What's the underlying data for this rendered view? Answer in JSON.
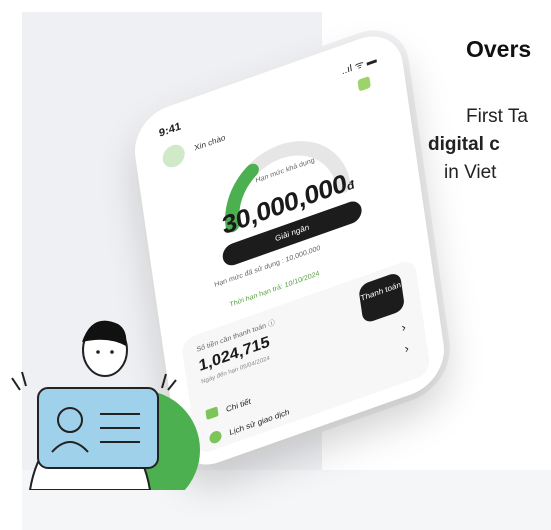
{
  "overview": {
    "heading": "Overs",
    "line1": "First Ta",
    "line2": "digital c",
    "line3": "in Viet"
  },
  "phone": {
    "time": "9:41",
    "signal": "..ıl ᯤ ▬",
    "greeting": "Xin chào",
    "limit_label": "Hạn mức khả dụng",
    "amount": "30,000,000",
    "currency": "đ",
    "disburse_button": "Giải ngân",
    "used_limit": "Hạn mức đã sử dụng : 10,000,000",
    "pay_hint": "Thời hạn hạn trả: 10/10/2024",
    "due_label": "Số tiền cần thanh toán ⓘ",
    "due_amount": "1,024,715",
    "due_date": "Ngày đến hạn 05/04/2024",
    "pay_button": "Thanh toán",
    "details": "Chi tiết",
    "history": "Lịch sử giao dịch"
  },
  "colors": {
    "accent_green": "#4caf50",
    "accent_yellow": "#f4c20d",
    "dark_button": "#1c1c1c"
  }
}
